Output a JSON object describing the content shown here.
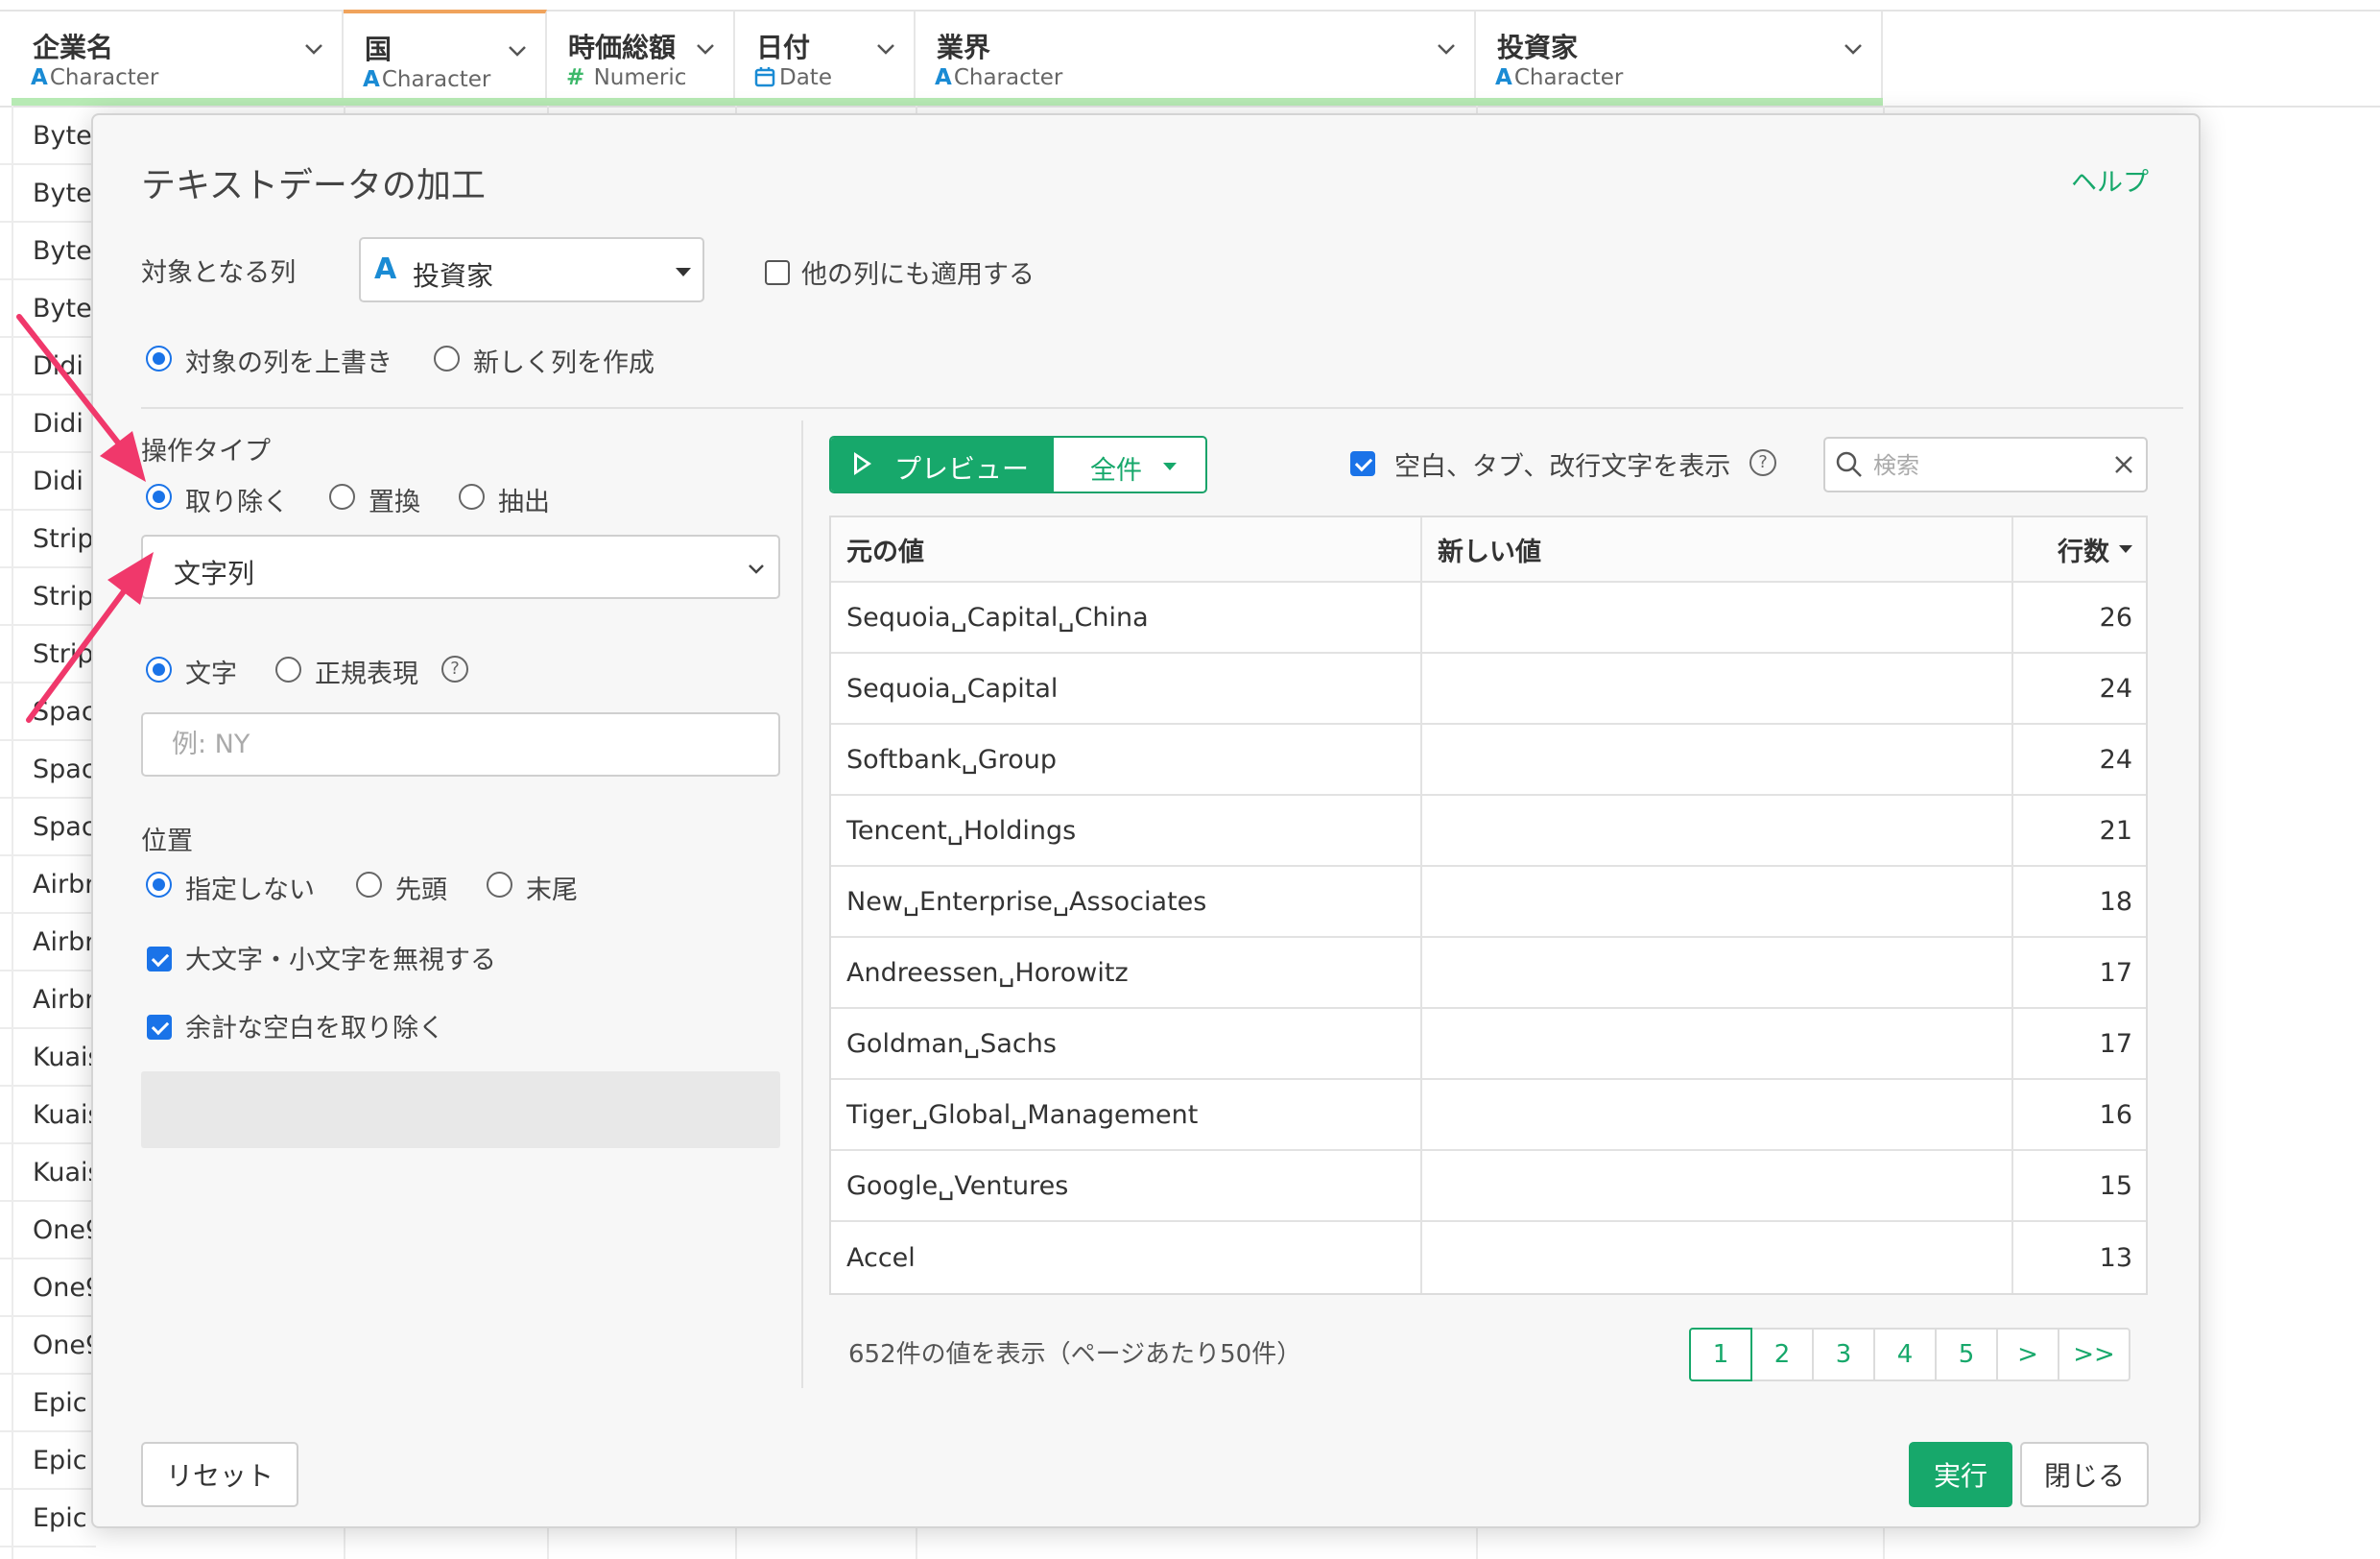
{
  "grid": {
    "columns": [
      {
        "name": "企業名",
        "type": "Character",
        "type_icon": "A"
      },
      {
        "name": "国",
        "type": "Character",
        "type_icon": "A"
      },
      {
        "name": "時価総額",
        "type": "Numeric",
        "type_icon": "#"
      },
      {
        "name": "日付",
        "type": "Date",
        "type_icon": "calendar-icon"
      },
      {
        "name": "業界",
        "type": "Character",
        "type_icon": "A"
      },
      {
        "name": "投資家",
        "type": "Character",
        "type_icon": "A"
      }
    ],
    "rows": [
      "Byte",
      "Byte",
      "Byte",
      "Byte",
      "Didi",
      "Didi",
      "Didi",
      "Strip",
      "Strip",
      "Strip",
      "Spac",
      "Spac",
      "Spac",
      "Airbn",
      "Airbn",
      "Airbn",
      "Kuais",
      "Kuais",
      "Kuais",
      "One9",
      "One9",
      "One9",
      "Epic",
      "Epic",
      "Epic"
    ]
  },
  "dialog": {
    "title": "テキストデータの加工",
    "help": "ヘルプ",
    "target_label": "対象となる列",
    "target_column": {
      "icon": "A",
      "value": "投資家"
    },
    "apply_other": {
      "label": "他の列にも適用する",
      "checked": false
    },
    "output_mode": {
      "overwrite": "対象の列を上書き",
      "new_column": "新しく列を作成",
      "selected": "overwrite"
    },
    "operation": {
      "label": "操作タイプ",
      "remove": "取り除く",
      "replace": "置換",
      "extract": "抽出",
      "selected": "remove"
    },
    "string_select": "文字列",
    "match_type": {
      "text": "文字",
      "regex": "正規表現",
      "selected": "text"
    },
    "input_placeholder": "例: NY",
    "position": {
      "label": "位置",
      "none": "指定しない",
      "start": "先頭",
      "end": "末尾",
      "selected": "none"
    },
    "ignore_case": {
      "label": "大文字・小文字を無視する",
      "checked": true
    },
    "trim_spaces": {
      "label": "余計な空白を取り除く",
      "checked": true
    },
    "reset": "リセット",
    "run": "実行",
    "close": "閉じる"
  },
  "preview": {
    "preview_button": "プレビュー",
    "all_button": "全件",
    "show_whitespace": {
      "label": "空白、タブ、改行文字を表示",
      "checked": true
    },
    "search_placeholder": "検索",
    "headers": {
      "original": "元の値",
      "new": "新しい値",
      "count": "行数"
    },
    "rows": [
      {
        "original": "Sequoia␣Capital␣China",
        "new": "",
        "count": "26"
      },
      {
        "original": "Sequoia␣Capital",
        "new": "",
        "count": "24"
      },
      {
        "original": "Softbank␣Group",
        "new": "",
        "count": "24"
      },
      {
        "original": "Tencent␣Holdings",
        "new": "",
        "count": "21"
      },
      {
        "original": "New␣Enterprise␣Associates",
        "new": "",
        "count": "18"
      },
      {
        "original": "Andreessen␣Horowitz",
        "new": "",
        "count": "17"
      },
      {
        "original": "Goldman␣Sachs",
        "new": "",
        "count": "17"
      },
      {
        "original": "Tiger␣Global␣Management",
        "new": "",
        "count": "16"
      },
      {
        "original": "Google␣Ventures",
        "new": "",
        "count": "15"
      },
      {
        "original": "Accel",
        "new": "",
        "count": "13"
      }
    ],
    "count_text": "652件の値を表示（ページあたり50件）",
    "pages": [
      "1",
      "2",
      "3",
      "4",
      "5",
      ">",
      ">>"
    ],
    "current_page": "1"
  },
  "colors": {
    "accent_green": "#17a86b",
    "checkbox_blue": "#1a73e8",
    "type_icon_blue": "#1a8bd4",
    "annotation_pink": "#f0386b"
  }
}
